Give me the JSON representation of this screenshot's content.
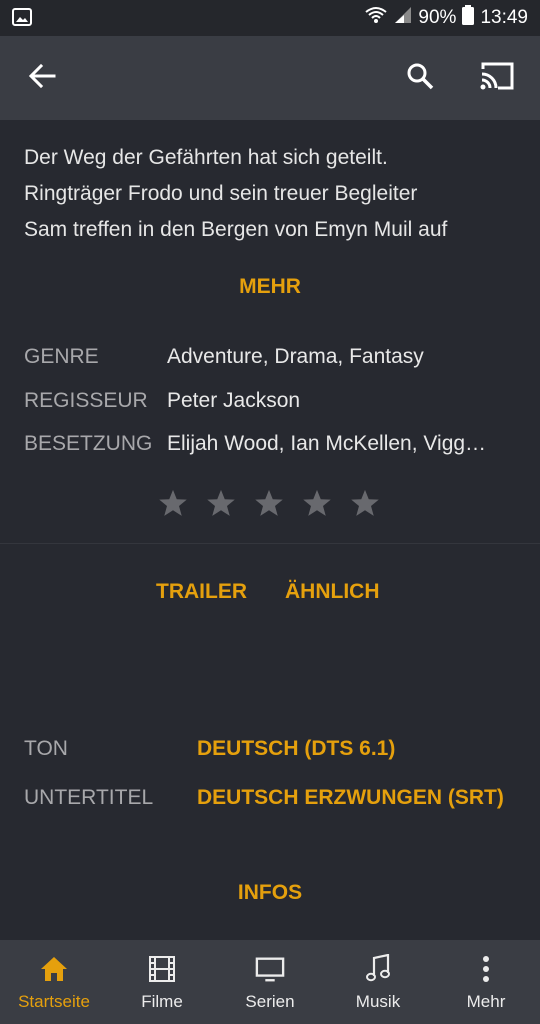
{
  "status_bar": {
    "icon_left": "image-icon",
    "battery": "90%",
    "time": "13:49"
  },
  "toolbar": {
    "back_icon": "arrow-back-icon",
    "search_icon": "search-icon",
    "cast_icon": "cast-icon"
  },
  "synopsis": {
    "lines": [
      "Der Weg der Gefährten hat sich geteilt.",
      "Ringträger Frodo und sein treuer Begleiter",
      "Sam treffen in den Bergen von Emyn Muil auf"
    ],
    "more_label": "MEHR"
  },
  "metadata": {
    "genre_label": "GENRE",
    "genre_value": "Adventure, Drama, Fantasy",
    "director_label": "REGISSEUR",
    "director_value": "Peter Jackson",
    "cast_label": "BESETZUNG",
    "cast_value": "Elijah Wood, Ian McKellen, Vigg…"
  },
  "rating": {
    "stars_filled": 0,
    "stars_total": 5
  },
  "tabs": [
    "TRAILER",
    "ÄHNLICH"
  ],
  "audio": {
    "audio_label": "TON",
    "audio_value": "DEUTSCH (DTS 6.1)",
    "subtitle_label": "UNTERTITEL",
    "subtitle_value": "DEUTSCH ERZWUNGEN (SRT)"
  },
  "infos_label": "INFOS",
  "bottom_nav": [
    {
      "label": "Startseite",
      "icon": "home-icon",
      "active": true
    },
    {
      "label": "Filme",
      "icon": "film-icon",
      "active": false
    },
    {
      "label": "Serien",
      "icon": "tv-icon",
      "active": false
    },
    {
      "label": "Musik",
      "icon": "music-icon",
      "active": false
    },
    {
      "label": "Mehr",
      "icon": "more-vert-icon",
      "active": false
    }
  ],
  "colors": {
    "accent": "#e5a00d",
    "background": "#272930",
    "bar": "#3a3d44"
  }
}
